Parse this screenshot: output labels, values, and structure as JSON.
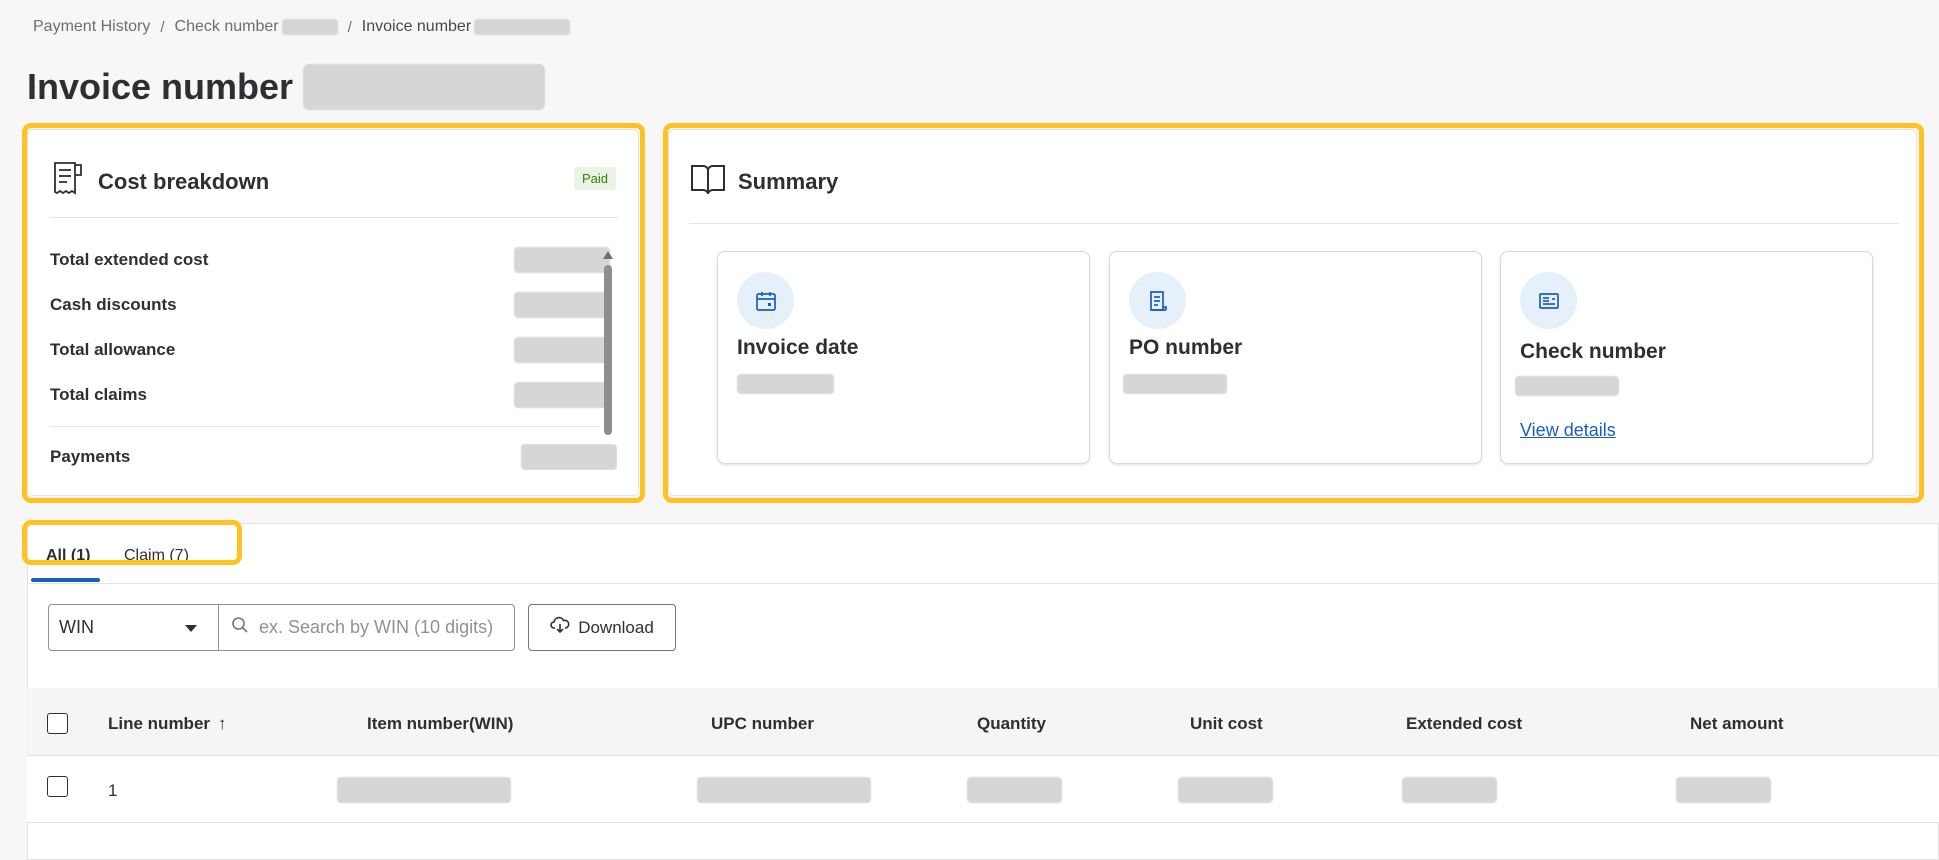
{
  "breadcrumb": {
    "items": [
      "Payment History",
      "Check number",
      "Invoice number"
    ],
    "separator": "/"
  },
  "page_title": "Invoice number",
  "cost_breakdown": {
    "title": "Cost breakdown",
    "icon": "receipt-icon",
    "status_badge": "Paid",
    "rows": [
      {
        "label": "Total extended cost"
      },
      {
        "label": "Cash discounts"
      },
      {
        "label": "Total allowance"
      },
      {
        "label": "Total claims"
      },
      {
        "label": "Payments"
      }
    ]
  },
  "summary": {
    "title": "Summary",
    "icon": "book-icon",
    "tiles": [
      {
        "label": "Invoice date",
        "icon": "calendar-icon"
      },
      {
        "label": "PO number",
        "icon": "document-icon"
      },
      {
        "label": "Check number",
        "icon": "check-icon",
        "link": "View details"
      }
    ]
  },
  "tabs": [
    {
      "label": "All (1)",
      "active": true
    },
    {
      "label": "Claim (7)",
      "active": false
    }
  ],
  "filter": {
    "select_value": "WIN",
    "search_placeholder": "ex. Search by WIN (10 digits)",
    "download_label": "Download"
  },
  "table": {
    "columns": [
      "Line number",
      "Item number(WIN)",
      "UPC number",
      "Quantity",
      "Unit cost",
      "Extended cost",
      "Net amount"
    ],
    "sort_indicator": "↑",
    "rows": [
      {
        "line_number": "1"
      }
    ]
  },
  "colors": {
    "highlight": "#ffc220",
    "link": "#1a5ec2",
    "badge_bg": "#eaf3e6",
    "badge_text": "#2a8703"
  }
}
